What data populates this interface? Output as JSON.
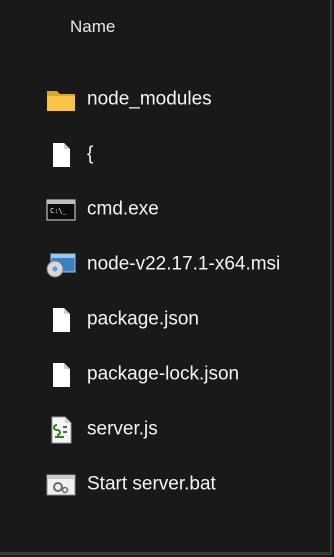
{
  "header": {
    "name_label": "Name"
  },
  "files": [
    {
      "label": "node_modules",
      "icon": "folder-icon"
    },
    {
      "label": "{",
      "icon": "file-icon"
    },
    {
      "label": "cmd.exe",
      "icon": "cmd-icon"
    },
    {
      "label": "node-v22.17.1-x64.msi",
      "icon": "installer-icon"
    },
    {
      "label": "package.json",
      "icon": "file-icon"
    },
    {
      "label": "package-lock.json",
      "icon": "file-icon"
    },
    {
      "label": "server.js",
      "icon": "javascript-file-icon"
    },
    {
      "label": "Start server.bat",
      "icon": "batch-file-icon"
    }
  ],
  "colors": {
    "background": "#191919",
    "folder": "#f4c145",
    "text": "#f4f4f4"
  }
}
